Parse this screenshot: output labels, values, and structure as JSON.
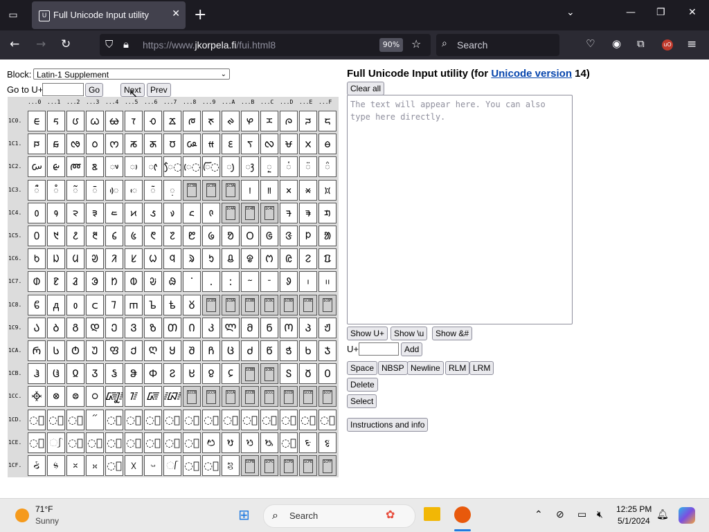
{
  "browser": {
    "tab_title": "Full Unicode Input utility",
    "url_prefix": "https://www.",
    "url_domain": "jkorpela.fi",
    "url_path": "/fui.html8",
    "zoom": "90%",
    "search_placeholder": "Search"
  },
  "controls": {
    "block_label": "Block:",
    "block_value": "Latin-1 Supplement",
    "goto_label": "Go to U+",
    "go": "Go",
    "next": "Next",
    "prev": "Prev"
  },
  "grid": {
    "columns": [
      "...0",
      "...1",
      "...2",
      "...3",
      "...4",
      "...5",
      "...6",
      "...7",
      "...8",
      "...9",
      "...A",
      "...B",
      "...C",
      "...D",
      "...E",
      "...F"
    ],
    "rows": [
      {
        "label": "1C0.",
        "cells": [
          "ᰀ",
          "ᰁ",
          "ᰂ",
          "ᰃ",
          "ᰄ",
          "ᰅ",
          "ᰆ",
          "ᰇ",
          "ᰈ",
          "ᰉ",
          "ᰊ",
          "ᰋ",
          "ᰌ",
          "ᰍ",
          "ᰎ",
          "ᰏ"
        ]
      },
      {
        "label": "1C1.",
        "cells": [
          "ᰐ",
          "ᰑ",
          "ᰒ",
          "ᰓ",
          "ᰔ",
          "ᰕ",
          "ᰖ",
          "ᰗ",
          "ᰘ",
          "ᰙ",
          "ᰚ",
          "ᰛ",
          "ᰜ",
          "ᰝ",
          "ᰞ",
          "ᰟ"
        ]
      },
      {
        "label": "1C2.",
        "cells": [
          "ᰠ",
          "ᰡ",
          "ᰢ",
          "ᰣ",
          "◌ᰤ",
          "◌ᰥ",
          "◌ᰦ",
          "ᰧ◌",
          "ᰨ◌",
          "ᰩ◌",
          "◌ᰪ",
          "◌ᰫ",
          "◌ᰬ",
          "◌ᰭ",
          "◌ᰮ",
          "◌ᰯ"
        ]
      },
      {
        "label": "1C3.",
        "cells": [
          "◌ᰰ",
          "◌ᰱ",
          "◌ᰲ",
          "◌ᰳ",
          "◌ᰴ",
          "◌ᰵ",
          "◌ᰶ",
          "◌᰷",
          "!1C38",
          "!1C39",
          "!1C3A",
          "᰻",
          "᰼",
          "᰽",
          "᰾",
          "᰿"
        ]
      },
      {
        "label": "1C4.",
        "cells": [
          "᱀",
          "᱁",
          "᱂",
          "᱃",
          "᱄",
          "᱅",
          "᱆",
          "᱇",
          "᱈",
          "᱉",
          "!1C4A",
          "!1C4B",
          "!1C4C",
          "ᱍ",
          "ᱎ",
          "ᱏ"
        ]
      },
      {
        "label": "1C5.",
        "cells": [
          "᱐",
          "᱑",
          "᱒",
          "᱓",
          "᱔",
          "᱕",
          "᱖",
          "᱗",
          "᱘",
          "᱙",
          "ᱚ",
          "ᱛ",
          "ᱜ",
          "ᱝ",
          "ᱞ",
          "ᱟ"
        ]
      },
      {
        "label": "1C6.",
        "cells": [
          "ᱠ",
          "ᱡ",
          "ᱢ",
          "ᱣ",
          "ᱤ",
          "ᱥ",
          "ᱦ",
          "ᱧ",
          "ᱨ",
          "ᱩ",
          "ᱪ",
          "ᱫ",
          "ᱬ",
          "ᱭ",
          "ᱮ",
          "ᱯ"
        ]
      },
      {
        "label": "1C7.",
        "cells": [
          "ᱰ",
          "ᱱ",
          "ᱲ",
          "ᱳ",
          "ᱴ",
          "ᱵ",
          "ᱶ",
          "ᱷ",
          "ᱸ",
          "ᱹ",
          "ᱺ",
          "ᱻ",
          "ᱼ",
          "ᱽ",
          "᱾",
          "᱿"
        ]
      },
      {
        "label": "1C8.",
        "cells": [
          "ᲀ",
          "ᲁ",
          "ᲂ",
          "ᲃ",
          "ᲄ",
          "ᲅ",
          "ᲆ",
          "ᲇ",
          "ᲈ",
          "!1C89",
          "!1C8A",
          "!1C8B",
          "!1C8C",
          "!1C8D",
          "!1C8E",
          "!1C8F"
        ]
      },
      {
        "label": "1C9.",
        "cells": [
          "Ა",
          "Ბ",
          "Გ",
          "Დ",
          "Ე",
          "Ვ",
          "Ზ",
          "Თ",
          "Ი",
          "Კ",
          "Ლ",
          "Მ",
          "Ნ",
          "Ო",
          "Პ",
          "Ჟ"
        ]
      },
      {
        "label": "1CA.",
        "cells": [
          "Რ",
          "Ს",
          "Ტ",
          "Უ",
          "Ფ",
          "Ქ",
          "Ღ",
          "Ყ",
          "Შ",
          "Ჩ",
          "Ც",
          "Ძ",
          "Წ",
          "Ჭ",
          "Ხ",
          "Ჯ"
        ]
      },
      {
        "label": "1CB.",
        "cells": [
          "Ჰ",
          "Ჱ",
          "Ჲ",
          "Ჳ",
          "Ჴ",
          "Ჵ",
          "Ჶ",
          "Ჷ",
          "Ჸ",
          "Ჹ",
          "Ჺ",
          "!1CBB",
          "!1CBC",
          "Ჽ",
          "Ჾ",
          "Ჿ"
        ]
      },
      {
        "label": "1CC.",
        "cells": [
          "᳀",
          "᳁",
          "᳂",
          "᳃",
          "᳄",
          "᳅",
          "᳆",
          "᳇",
          "!1CC8",
          "!1CC9",
          "!1CCA",
          "!1CCB",
          "!1CCC",
          "!1CCD",
          "!1CCE",
          "!1CCF"
        ]
      },
      {
        "label": "1CD.",
        "cells": [
          "◌᳐",
          "◌᳑",
          "◌᳒",
          "᳓",
          "◌᳔",
          "◌᳕",
          "◌᳖",
          "◌᳗",
          "◌᳘",
          "◌᳙",
          "◌᳚",
          "◌᳛",
          "◌᳜",
          "◌᳝",
          "◌᳞",
          "◌᳟"
        ]
      },
      {
        "label": "1CE.",
        "cells": [
          "◌᳠",
          "᳡",
          "◌᳢",
          "◌᳣",
          "◌᳤",
          "◌᳥",
          "◌᳦",
          "◌᳧",
          "◌᳨",
          "ᳩ",
          "ᳪ",
          "ᳫ",
          "ᳬ",
          "◌᳭",
          "ᳮ",
          "ᳯ"
        ]
      },
      {
        "label": "1CF.",
        "cells": [
          "ᳰ",
          "ᳱ",
          "ᳲ",
          "ᳳ",
          "◌᳴",
          "ᳵ",
          "ᳶ",
          "᳷",
          "◌᳸",
          "◌᳹",
          "ᳺ",
          "!1CFB",
          "!1CFC",
          "!1CFD",
          "!1CFE",
          "!1CFF"
        ]
      }
    ]
  },
  "right": {
    "heading_prefix": "Full Unicode Input utility (for ",
    "heading_link": "Unicode version",
    "heading_suffix": " 14)",
    "clear_all": "Clear all",
    "textarea_placeholder": "The text will appear here. You can also type here directly.",
    "show_u": "Show U+",
    "show_backslash_u": "Show \\u",
    "show_amp": "Show &#",
    "uplus_label": "U+",
    "add": "Add",
    "space": "Space",
    "nbsp": "NBSP",
    "newline": "Newline",
    "rlm": "RLM",
    "lrm": "LRM",
    "delete": "Delete",
    "select": "Select",
    "instructions": "Instructions and info"
  },
  "taskbar": {
    "temp": "71°F",
    "condition": "Sunny",
    "search": "Search",
    "time": "12:25 PM",
    "date": "5/1/2024"
  },
  "colors": {
    "link": "#0645ad",
    "firefox_dark": "#1c1b22"
  }
}
